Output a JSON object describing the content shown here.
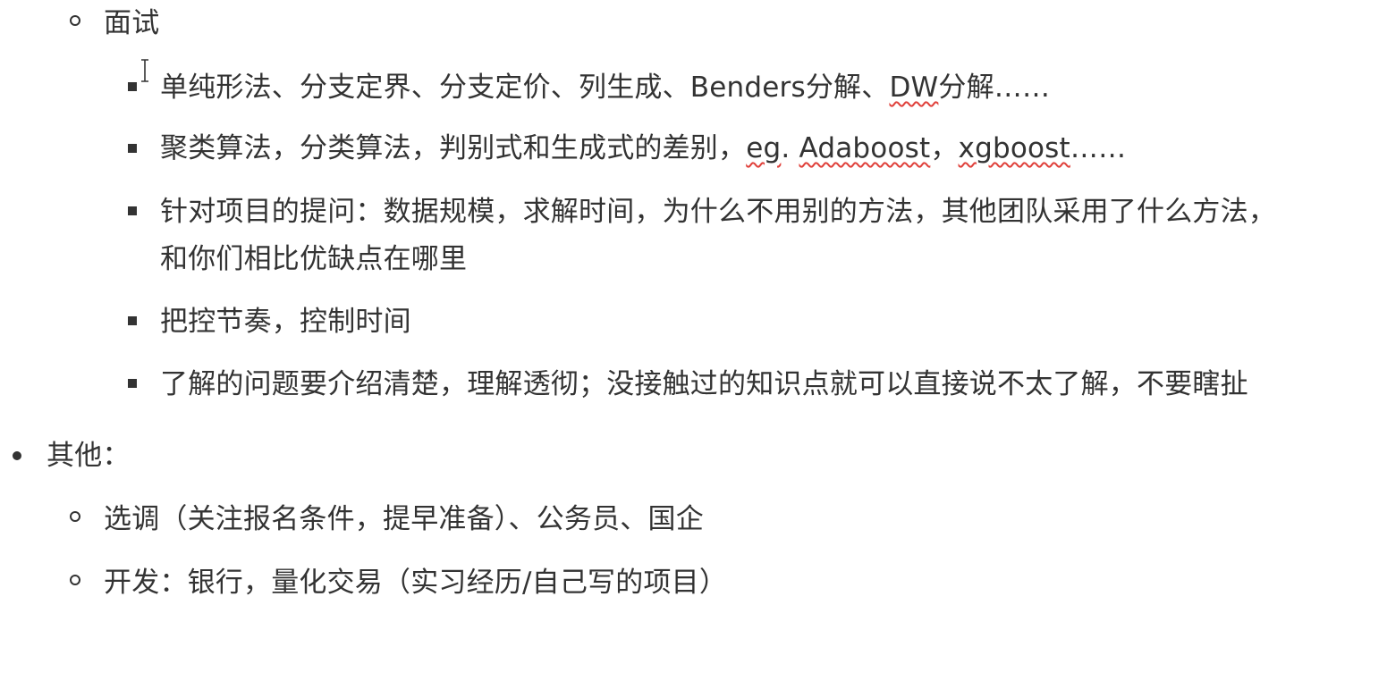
{
  "document": {
    "interview": {
      "heading": "面试",
      "items": [
        {
          "parts": [
            {
              "text": "单纯形法、分支定界、分支定价、列生成、Benders分解、",
              "spell": false
            },
            {
              "text": "DW",
              "spell": true
            },
            {
              "text": "分解……",
              "spell": false
            }
          ]
        },
        {
          "parts": [
            {
              "text": "聚类算法，分类算法，判别式和生成式的差别，",
              "spell": false
            },
            {
              "text": "eg",
              "spell": true
            },
            {
              "text": ". ",
              "spell": false
            },
            {
              "text": "Adaboost",
              "spell": true
            },
            {
              "text": "，",
              "spell": false
            },
            {
              "text": "xgboost",
              "spell": true
            },
            {
              "text": "……",
              "spell": false
            }
          ]
        },
        {
          "line1": "针对项目的提问：数据规模，求解时间，为什么不用别的方法，其他团队采用了什么方法，",
          "line2": "和你们相比优缺点在哪里"
        },
        {
          "line1": "把控节奏，控制时间"
        },
        {
          "line1": "了解的问题要介绍清楚，理解透彻；没接触过的知识点就可以直接说不太了解，不要瞎扯"
        }
      ]
    },
    "other": {
      "heading": "其他：",
      "items": [
        "选调（关注报名条件，提早准备）、公务员、国企",
        "开发：银行，量化交易（实习经历/自己写的项目）"
      ]
    }
  },
  "colors": {
    "text": "#333333",
    "spellcheck": "#e0403a",
    "background": "#ffffff"
  },
  "icons": {
    "cursor": "text-cursor-icon"
  }
}
